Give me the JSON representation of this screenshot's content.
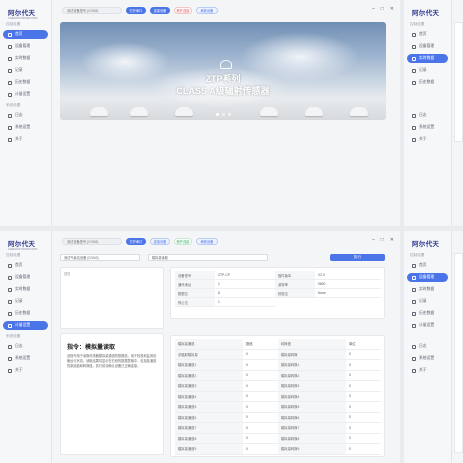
{
  "app": {
    "logo_text": "阿尔代天",
    "logo_sub": "GREENSSTARSENSORS"
  },
  "sidebar": {
    "group1": "控制设置",
    "group2": "系统设置",
    "items": [
      {
        "label": "首页"
      },
      {
        "label": "设备管理"
      },
      {
        "label": "实时数据"
      },
      {
        "label": "记录"
      },
      {
        "label": "历史数据"
      },
      {
        "label": "计量设置"
      }
    ],
    "items2": [
      {
        "label": "日志"
      },
      {
        "label": "系统设置"
      },
      {
        "label": "关于"
      }
    ]
  },
  "topbar": {
    "device_select": "测试设备型号 (COM3)",
    "connect_label": "打开串口",
    "device_button": "连接设备",
    "disconnect_label": "断开连接",
    "refresh_label": "刷新设备"
  },
  "banner": {
    "title": "ZTP系列",
    "subtitle": "CLASS A级辐射传感器"
  },
  "command_view": {
    "select_left": "测试气象站设备 (COM3)",
    "select_right": "模拟量读取",
    "run_label": "执行",
    "textarea_placeholder": "回复",
    "title": "指令：模拟量读取",
    "description": "该指令用于读取传感器模拟量通道的数据值，用于校准和监测设备运行状态。读取结果将显示在右侧的数据表格中，包括各通道的原始值和转换值。执行前请确认设备已正确连接。",
    "info": [
      {
        "label": "设备型号",
        "value": "ZTP-CP"
      },
      {
        "label": "固件版本",
        "value": "V2.0"
      },
      {
        "label": "通讯地址",
        "value": "1"
      },
      {
        "label": "波特率",
        "value": "9600"
      },
      {
        "label": "数据位",
        "value": "8"
      },
      {
        "label": "校验位",
        "value": "None"
      },
      {
        "label": "停止位",
        "value": "1"
      }
    ],
    "table": [
      {
        "k1": "模拟量通道",
        "v1": "数值",
        "k2": "转换值",
        "v2": "单位"
      },
      {
        "k1": "总辐射模拟量",
        "v1": "0",
        "k2": "模拟量转换",
        "v2": "0"
      },
      {
        "k1": "模拟量通道1",
        "v1": "0",
        "k2": "模拟量转换1",
        "v2": "0"
      },
      {
        "k1": "模拟量通道2",
        "v1": "0",
        "k2": "模拟量转换2",
        "v2": "0"
      },
      {
        "k1": "模拟量通道3",
        "v1": "0",
        "k2": "模拟量转换3",
        "v2": "0"
      },
      {
        "k1": "模拟量通道4",
        "v1": "0",
        "k2": "模拟量转换4",
        "v2": "0"
      },
      {
        "k1": "模拟量通道5",
        "v1": "0",
        "k2": "模拟量转换5",
        "v2": "0"
      },
      {
        "k1": "模拟量通道6",
        "v1": "0",
        "k2": "模拟量转换6",
        "v2": "0"
      },
      {
        "k1": "模拟量通道7",
        "v1": "0",
        "k2": "模拟量转换7",
        "v2": "0"
      },
      {
        "k1": "模拟量通道8",
        "v1": "0",
        "k2": "模拟量转换8",
        "v2": "0"
      },
      {
        "k1": "模拟量通道9",
        "v1": "0",
        "k2": "模拟量转换9",
        "v2": "0"
      }
    ]
  },
  "colors": {
    "accent": "#4a74e8",
    "danger": "#e24a4a",
    "success": "#2faa55"
  }
}
